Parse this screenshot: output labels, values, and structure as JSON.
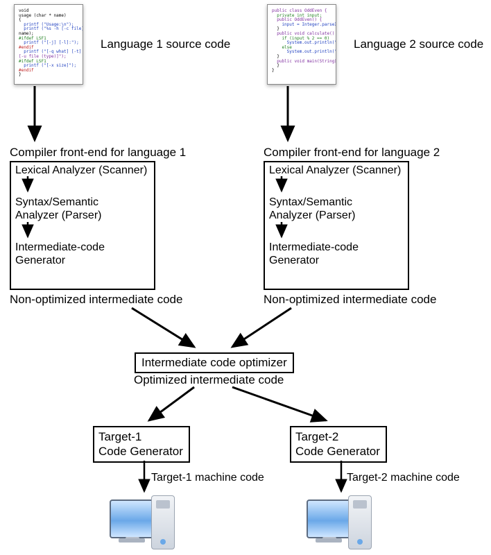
{
  "labels": {
    "src1": "Language 1 source code",
    "src2": "Language 2 source code",
    "fe1_title": "Compiler front-end for language 1",
    "fe2_title": "Compiler front-end for language 2",
    "nonopt1": "Non-optimized intermediate code",
    "nonopt2": "Non-optimized intermediate code",
    "optimizer": "Intermediate code optimizer",
    "optimized": "Optimized intermediate code",
    "target1_code": "Target-1 machine code",
    "target2_code": "Target-2 machine code"
  },
  "frontend_stages": {
    "s1": "Lexical Analyzer (Scanner)",
    "s2a": "Syntax/Semantic",
    "s2b": "Analyzer (Parser)",
    "s3a": "Intermediate-code",
    "s3b": "Generator"
  },
  "target_boxes": {
    "t1a": "Target-1",
    "t1b": "Code Generator",
    "t2a": "Target-2",
    "t2b": "Code Generator"
  },
  "code1": [
    {
      "cls": "c-black",
      "txt": "void"
    },
    {
      "cls": "c-black",
      "txt": "usage (char * name)"
    },
    {
      "cls": "c-black",
      "txt": "{"
    },
    {
      "cls": "c-blue",
      "txt": "  printf (\"Usage:\\n\");"
    },
    {
      "cls": "c-blue",
      "txt": "  printf (\"%s -h [-c file]\","
    },
    {
      "cls": "c-black",
      "txt": "name);"
    },
    {
      "cls": "c-green",
      "txt": "#ifdef LSF1"
    },
    {
      "cls": "c-blue",
      "txt": "  printf (\"[-j] [-l]:\");"
    },
    {
      "cls": "c-red",
      "txt": "#endif"
    },
    {
      "cls": "c-blue",
      "txt": "  printf (\"[-q what] [-t]"
    },
    {
      "cls": "c-purple",
      "txt": "[-u file (type)]\");"
    },
    {
      "cls": "c-green",
      "txt": "#ifdef LSF1"
    },
    {
      "cls": "c-blue",
      "txt": "  printf (\"[-x size]\");"
    },
    {
      "cls": "c-red",
      "txt": "#endif"
    },
    {
      "cls": "c-black",
      "txt": "}"
    }
  ],
  "code2": [
    {
      "cls": "c-purple",
      "txt": "public class OddEven {"
    },
    {
      "cls": "c-green",
      "txt": "  private int input;"
    },
    {
      "cls": "c-purple",
      "txt": "  public OddEven() {"
    },
    {
      "cls": "c-blue",
      "txt": "    input = Integer.parseInt()"
    },
    {
      "cls": "c-black",
      "txt": "  }"
    },
    {
      "cls": "c-purple",
      "txt": "  public void calculate() {"
    },
    {
      "cls": "c-green",
      "txt": "    if (input % 2 == 0)"
    },
    {
      "cls": "c-blue",
      "txt": "      System.out.println(\"Even\");"
    },
    {
      "cls": "c-green",
      "txt": "    else"
    },
    {
      "cls": "c-blue",
      "txt": "      System.out.println(\"Odd\");"
    },
    {
      "cls": "c-black",
      "txt": "  }"
    },
    {
      "cls": "c-purple",
      "txt": "  public void main(String[] args) {"
    },
    {
      "cls": "c-black",
      "txt": "  }"
    },
    {
      "cls": "c-black",
      "txt": "}"
    }
  ]
}
